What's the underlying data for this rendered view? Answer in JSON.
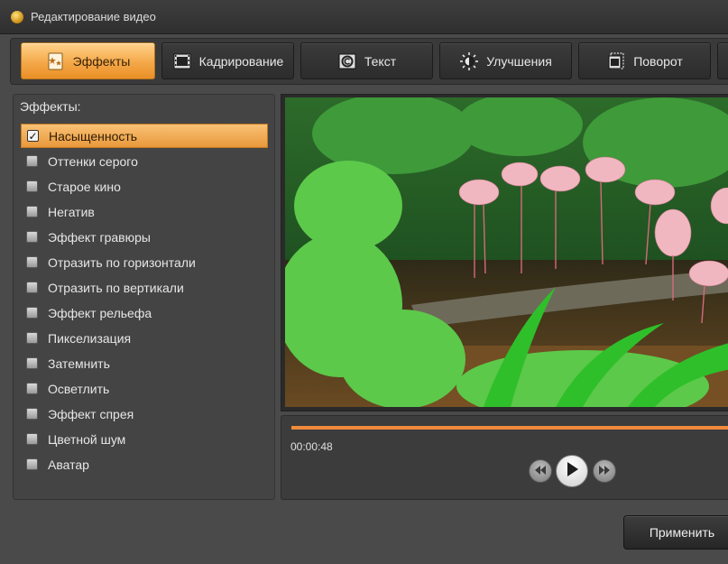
{
  "window": {
    "title": "Редактирование видео",
    "icon": "app-logo-icon"
  },
  "tabs": [
    {
      "label": "Эффекты",
      "icon": "effects-icon",
      "active": true
    },
    {
      "label": "Кадрирование",
      "icon": "crop-film-icon",
      "active": false
    },
    {
      "label": "Текст",
      "icon": "text-icon",
      "active": false
    },
    {
      "label": "Улучшения",
      "icon": "sun-brightness-icon",
      "active": false
    },
    {
      "label": "Поворот",
      "icon": "rotate-icon",
      "active": false
    }
  ],
  "effects": {
    "header": "Эффекты:",
    "items": [
      {
        "label": "Насыщенность",
        "checked": true,
        "selected": true
      },
      {
        "label": "Оттенки серого",
        "checked": false
      },
      {
        "label": "Старое кино",
        "checked": false
      },
      {
        "label": "Негатив",
        "checked": false
      },
      {
        "label": "Эффект гравюры",
        "checked": false
      },
      {
        "label": "Отразить по горизонтали",
        "checked": false
      },
      {
        "label": "Отразить по вертикали",
        "checked": false
      },
      {
        "label": "Эффект рельефа",
        "checked": false
      },
      {
        "label": "Пикселизация",
        "checked": false
      },
      {
        "label": "Затемнить",
        "checked": false
      },
      {
        "label": "Осветлить",
        "checked": false
      },
      {
        "label": "Эффект спрея",
        "checked": false
      },
      {
        "label": "Цветной шум",
        "checked": false
      },
      {
        "label": "Аватар",
        "checked": false
      }
    ]
  },
  "player": {
    "timecode": "00:00:48",
    "progress": 1.0,
    "buttons": {
      "prev": "skip-back-icon",
      "play": "play-icon",
      "next": "skip-forward-icon"
    }
  },
  "footer": {
    "apply_label": "Применить"
  },
  "colors": {
    "accent": "#f4a849",
    "progress": "#f08a3a",
    "background": "#4a4a4a"
  }
}
